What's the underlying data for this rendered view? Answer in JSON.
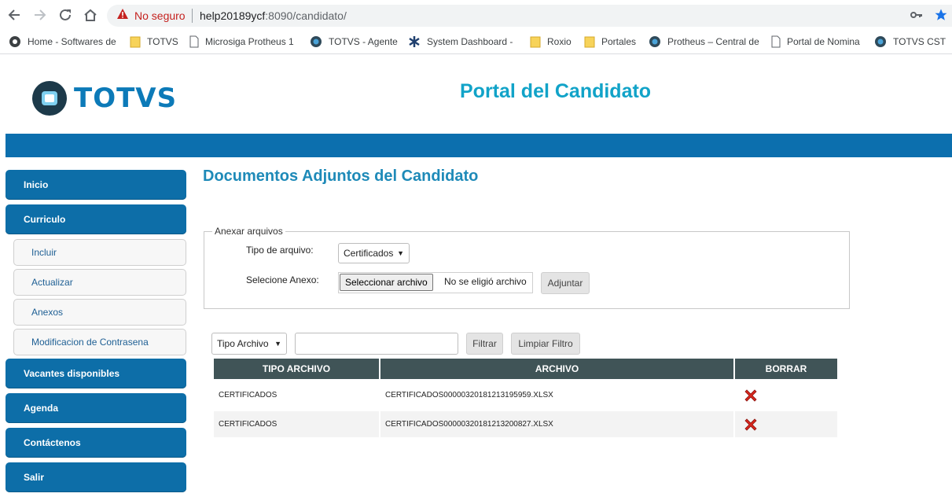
{
  "browser": {
    "security_label": "No seguro",
    "url_host": "help20189ycf",
    "url_rest": ":8090/candidato/"
  },
  "bookmarks": [
    {
      "label": "Home - Softwares de",
      "icon": "globe-icon"
    },
    {
      "label": "TOTVS",
      "icon": "folder-icon"
    },
    {
      "label": "Microsiga Protheus 1",
      "icon": "page-icon"
    },
    {
      "label": "TOTVS - Agente",
      "icon": "totvs-icon"
    },
    {
      "label": "System Dashboard -",
      "icon": "dashboard-icon"
    },
    {
      "label": "Roxio",
      "icon": "folder-icon"
    },
    {
      "label": "Portales",
      "icon": "folder-icon"
    },
    {
      "label": "Protheus – Central de",
      "icon": "totvs-icon"
    },
    {
      "label": "Portal de Nomina",
      "icon": "page-icon"
    },
    {
      "label": "TOTVS CST",
      "icon": "totvs-icon"
    }
  ],
  "header": {
    "logo_text": "TOTVS",
    "portal_title": "Portal del Candidato"
  },
  "sidebar": {
    "inicio": "Inicio",
    "curriculo": "Curriculo",
    "incluir": "Incluir",
    "actualizar": "Actualizar",
    "anexos": "Anexos",
    "modificacion": "Modificacion de Contrasena",
    "vacantes": "Vacantes disponibles",
    "agenda": "Agenda",
    "contactenos": "Contáctenos",
    "salir": "Salir"
  },
  "main": {
    "title": "Documentos Adjuntos del Candidato",
    "legend": "Anexar arquivos",
    "tipo_label": "Tipo de arquivo:",
    "tipo_value": "Certificados",
    "anexo_label": "Selecione Anexo:",
    "file_button": "Seleccionar archivo",
    "file_status": "No se eligió archivo",
    "adjuntar": "Adjuntar",
    "filter_select": "Tipo Archivo",
    "filter_input_value": "",
    "filtrar": "Filtrar",
    "limpiar": "Limpiar Filtro"
  },
  "table": {
    "headers": [
      "TIPO ARCHIVO",
      "ARCHIVO",
      "BORRAR"
    ],
    "rows": [
      {
        "tipo": "CERTIFICADOS",
        "archivo": "CERTIFICADOS000003201812131959​59.XLSX"
      },
      {
        "tipo": "CERTIFICADOS",
        "archivo": "CERTIFICADOS00000320181213200827.XLSX"
      }
    ]
  },
  "colors": {
    "brand_blue": "#0c6fae",
    "title_cyan": "#11a3c8",
    "table_header": "#405457",
    "delete_red": "#d9261c"
  }
}
